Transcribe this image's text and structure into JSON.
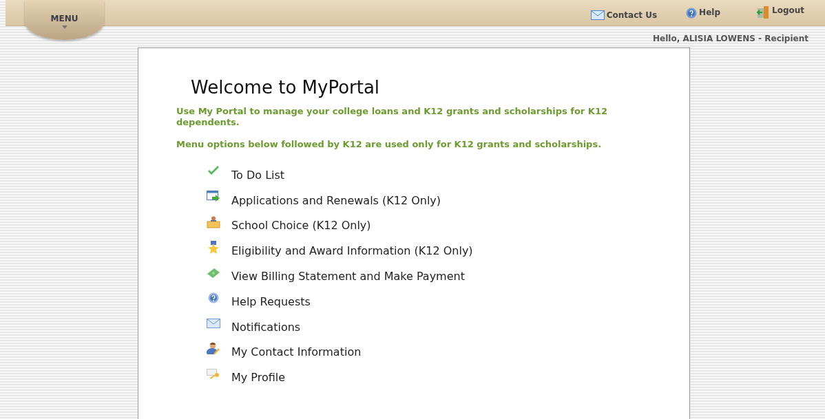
{
  "top_bar": {
    "menu_label": "MENU",
    "links": [
      {
        "label": "Contact Us",
        "kind": "mail"
      },
      {
        "label": "Help",
        "kind": "help"
      },
      {
        "label": "Logout",
        "kind": "logout"
      }
    ]
  },
  "greeting": "Hello, ALISIA LOWENS - Recipient",
  "content": {
    "title": "Welcome to MyPortal",
    "intro": "Use My Portal to manage your college loans and K12 grants and scholarships for K12 dependents.",
    "note": "Menu options below followed by K12 are used only for K12 grants and scholarships.",
    "menu_items": [
      {
        "label": "To Do List",
        "kind": "check"
      },
      {
        "label": "Applications and Renewals (K12 Only)",
        "kind": "application"
      },
      {
        "label": "School Choice (K12 Only)",
        "kind": "school"
      },
      {
        "label": "Eligibility and Award Information (K12 Only)",
        "kind": "award"
      },
      {
        "label": "View Billing Statement and Make Payment",
        "kind": "money"
      },
      {
        "label": "Help Requests",
        "kind": "help"
      },
      {
        "label": "Notifications",
        "kind": "mail"
      },
      {
        "label": "My Contact Information",
        "kind": "contact"
      },
      {
        "label": "My Profile",
        "kind": "profile"
      }
    ]
  }
}
